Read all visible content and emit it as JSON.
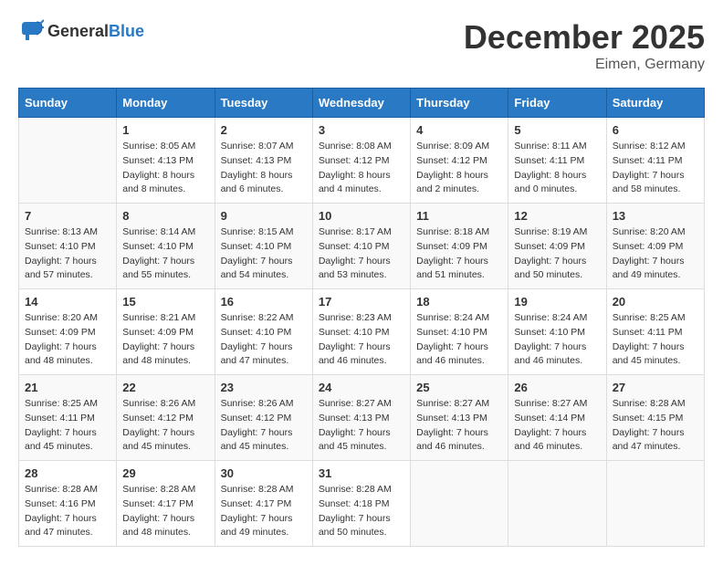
{
  "header": {
    "logo_general": "General",
    "logo_blue": "Blue",
    "month_title": "December 2025",
    "location": "Eimen, Germany"
  },
  "days_of_week": [
    "Sunday",
    "Monday",
    "Tuesday",
    "Wednesday",
    "Thursday",
    "Friday",
    "Saturday"
  ],
  "weeks": [
    [
      {
        "day": "",
        "sunrise": "",
        "sunset": "",
        "daylight": "",
        "empty": true
      },
      {
        "day": "1",
        "sunrise": "Sunrise: 8:05 AM",
        "sunset": "Sunset: 4:13 PM",
        "daylight": "Daylight: 8 hours and 8 minutes.",
        "empty": false
      },
      {
        "day": "2",
        "sunrise": "Sunrise: 8:07 AM",
        "sunset": "Sunset: 4:13 PM",
        "daylight": "Daylight: 8 hours and 6 minutes.",
        "empty": false
      },
      {
        "day": "3",
        "sunrise": "Sunrise: 8:08 AM",
        "sunset": "Sunset: 4:12 PM",
        "daylight": "Daylight: 8 hours and 4 minutes.",
        "empty": false
      },
      {
        "day": "4",
        "sunrise": "Sunrise: 8:09 AM",
        "sunset": "Sunset: 4:12 PM",
        "daylight": "Daylight: 8 hours and 2 minutes.",
        "empty": false
      },
      {
        "day": "5",
        "sunrise": "Sunrise: 8:11 AM",
        "sunset": "Sunset: 4:11 PM",
        "daylight": "Daylight: 8 hours and 0 minutes.",
        "empty": false
      },
      {
        "day": "6",
        "sunrise": "Sunrise: 8:12 AM",
        "sunset": "Sunset: 4:11 PM",
        "daylight": "Daylight: 7 hours and 58 minutes.",
        "empty": false
      }
    ],
    [
      {
        "day": "7",
        "sunrise": "Sunrise: 8:13 AM",
        "sunset": "Sunset: 4:10 PM",
        "daylight": "Daylight: 7 hours and 57 minutes.",
        "empty": false
      },
      {
        "day": "8",
        "sunrise": "Sunrise: 8:14 AM",
        "sunset": "Sunset: 4:10 PM",
        "daylight": "Daylight: 7 hours and 55 minutes.",
        "empty": false
      },
      {
        "day": "9",
        "sunrise": "Sunrise: 8:15 AM",
        "sunset": "Sunset: 4:10 PM",
        "daylight": "Daylight: 7 hours and 54 minutes.",
        "empty": false
      },
      {
        "day": "10",
        "sunrise": "Sunrise: 8:17 AM",
        "sunset": "Sunset: 4:10 PM",
        "daylight": "Daylight: 7 hours and 53 minutes.",
        "empty": false
      },
      {
        "day": "11",
        "sunrise": "Sunrise: 8:18 AM",
        "sunset": "Sunset: 4:09 PM",
        "daylight": "Daylight: 7 hours and 51 minutes.",
        "empty": false
      },
      {
        "day": "12",
        "sunrise": "Sunrise: 8:19 AM",
        "sunset": "Sunset: 4:09 PM",
        "daylight": "Daylight: 7 hours and 50 minutes.",
        "empty": false
      },
      {
        "day": "13",
        "sunrise": "Sunrise: 8:20 AM",
        "sunset": "Sunset: 4:09 PM",
        "daylight": "Daylight: 7 hours and 49 minutes.",
        "empty": false
      }
    ],
    [
      {
        "day": "14",
        "sunrise": "Sunrise: 8:20 AM",
        "sunset": "Sunset: 4:09 PM",
        "daylight": "Daylight: 7 hours and 48 minutes.",
        "empty": false
      },
      {
        "day": "15",
        "sunrise": "Sunrise: 8:21 AM",
        "sunset": "Sunset: 4:09 PM",
        "daylight": "Daylight: 7 hours and 48 minutes.",
        "empty": false
      },
      {
        "day": "16",
        "sunrise": "Sunrise: 8:22 AM",
        "sunset": "Sunset: 4:10 PM",
        "daylight": "Daylight: 7 hours and 47 minutes.",
        "empty": false
      },
      {
        "day": "17",
        "sunrise": "Sunrise: 8:23 AM",
        "sunset": "Sunset: 4:10 PM",
        "daylight": "Daylight: 7 hours and 46 minutes.",
        "empty": false
      },
      {
        "day": "18",
        "sunrise": "Sunrise: 8:24 AM",
        "sunset": "Sunset: 4:10 PM",
        "daylight": "Daylight: 7 hours and 46 minutes.",
        "empty": false
      },
      {
        "day": "19",
        "sunrise": "Sunrise: 8:24 AM",
        "sunset": "Sunset: 4:10 PM",
        "daylight": "Daylight: 7 hours and 46 minutes.",
        "empty": false
      },
      {
        "day": "20",
        "sunrise": "Sunrise: 8:25 AM",
        "sunset": "Sunset: 4:11 PM",
        "daylight": "Daylight: 7 hours and 45 minutes.",
        "empty": false
      }
    ],
    [
      {
        "day": "21",
        "sunrise": "Sunrise: 8:25 AM",
        "sunset": "Sunset: 4:11 PM",
        "daylight": "Daylight: 7 hours and 45 minutes.",
        "empty": false
      },
      {
        "day": "22",
        "sunrise": "Sunrise: 8:26 AM",
        "sunset": "Sunset: 4:12 PM",
        "daylight": "Daylight: 7 hours and 45 minutes.",
        "empty": false
      },
      {
        "day": "23",
        "sunrise": "Sunrise: 8:26 AM",
        "sunset": "Sunset: 4:12 PM",
        "daylight": "Daylight: 7 hours and 45 minutes.",
        "empty": false
      },
      {
        "day": "24",
        "sunrise": "Sunrise: 8:27 AM",
        "sunset": "Sunset: 4:13 PM",
        "daylight": "Daylight: 7 hours and 45 minutes.",
        "empty": false
      },
      {
        "day": "25",
        "sunrise": "Sunrise: 8:27 AM",
        "sunset": "Sunset: 4:13 PM",
        "daylight": "Daylight: 7 hours and 46 minutes.",
        "empty": false
      },
      {
        "day": "26",
        "sunrise": "Sunrise: 8:27 AM",
        "sunset": "Sunset: 4:14 PM",
        "daylight": "Daylight: 7 hours and 46 minutes.",
        "empty": false
      },
      {
        "day": "27",
        "sunrise": "Sunrise: 8:28 AM",
        "sunset": "Sunset: 4:15 PM",
        "daylight": "Daylight: 7 hours and 47 minutes.",
        "empty": false
      }
    ],
    [
      {
        "day": "28",
        "sunrise": "Sunrise: 8:28 AM",
        "sunset": "Sunset: 4:16 PM",
        "daylight": "Daylight: 7 hours and 47 minutes.",
        "empty": false
      },
      {
        "day": "29",
        "sunrise": "Sunrise: 8:28 AM",
        "sunset": "Sunset: 4:17 PM",
        "daylight": "Daylight: 7 hours and 48 minutes.",
        "empty": false
      },
      {
        "day": "30",
        "sunrise": "Sunrise: 8:28 AM",
        "sunset": "Sunset: 4:17 PM",
        "daylight": "Daylight: 7 hours and 49 minutes.",
        "empty": false
      },
      {
        "day": "31",
        "sunrise": "Sunrise: 8:28 AM",
        "sunset": "Sunset: 4:18 PM",
        "daylight": "Daylight: 7 hours and 50 minutes.",
        "empty": false
      },
      {
        "day": "",
        "sunrise": "",
        "sunset": "",
        "daylight": "",
        "empty": true
      },
      {
        "day": "",
        "sunrise": "",
        "sunset": "",
        "daylight": "",
        "empty": true
      },
      {
        "day": "",
        "sunrise": "",
        "sunset": "",
        "daylight": "",
        "empty": true
      }
    ]
  ]
}
